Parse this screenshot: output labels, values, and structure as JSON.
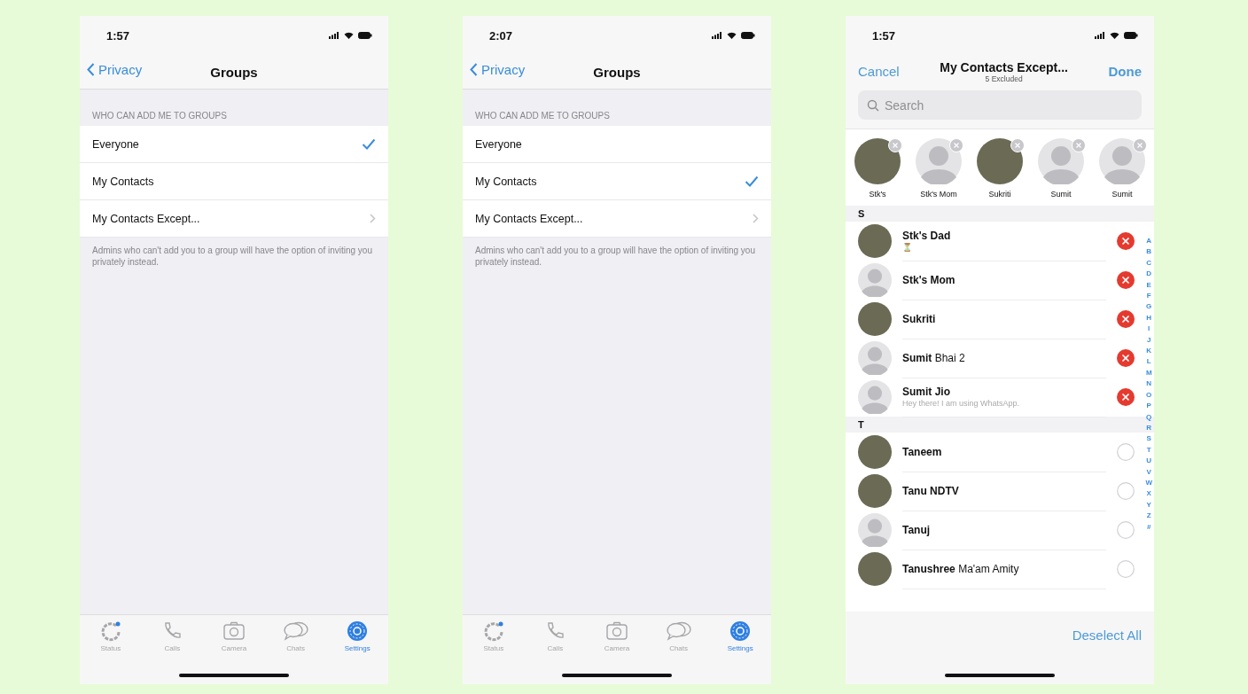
{
  "screens": [
    {
      "kind": "settings",
      "time": "1:57",
      "back_label": "Privacy",
      "title": "Groups",
      "section_header": "WHO CAN ADD ME TO GROUPS",
      "options": [
        {
          "label": "Everyone",
          "selected": true,
          "chevron": false
        },
        {
          "label": "My Contacts",
          "selected": false,
          "chevron": false
        },
        {
          "label": "My Contacts Except...",
          "selected": false,
          "chevron": true
        }
      ],
      "footer": "Admins who can't add you to a group will have the option of inviting you privately instead.",
      "tabs": [
        {
          "label": "Status",
          "selected": false
        },
        {
          "label": "Calls",
          "selected": false
        },
        {
          "label": "Camera",
          "selected": false
        },
        {
          "label": "Chats",
          "selected": false
        },
        {
          "label": "Settings",
          "selected": true
        }
      ]
    },
    {
      "kind": "settings",
      "time": "2:07",
      "back_label": "Privacy",
      "title": "Groups",
      "section_header": "WHO CAN ADD ME TO GROUPS",
      "options": [
        {
          "label": "Everyone",
          "selected": false,
          "chevron": false
        },
        {
          "label": "My Contacts",
          "selected": true,
          "chevron": false
        },
        {
          "label": "My Contacts Except...",
          "selected": false,
          "chevron": true
        }
      ],
      "footer": "Admins who can't add you to a group will have the option of inviting you privately instead.",
      "tabs": [
        {
          "label": "Status",
          "selected": false
        },
        {
          "label": "Calls",
          "selected": false
        },
        {
          "label": "Camera",
          "selected": false
        },
        {
          "label": "Chats",
          "selected": false
        },
        {
          "label": "Settings",
          "selected": true
        }
      ]
    },
    {
      "kind": "picker",
      "time": "1:57",
      "cancel": "Cancel",
      "title": "My Contacts Except...",
      "subtitle": "5 Excluded",
      "done": "Done",
      "search": {
        "placeholder": "Search"
      },
      "chips": [
        {
          "name": "Stk's",
          "photo": true
        },
        {
          "name": "Stk's Mom",
          "photo": false
        },
        {
          "name": "Sukriti",
          "photo": true
        },
        {
          "name": "Sumit",
          "photo": false
        },
        {
          "name": "Sumit",
          "photo": false
        }
      ],
      "sections": [
        {
          "letter": "S",
          "contacts": [
            {
              "name": "Stk's Dad",
              "bold": true,
              "status": "⏳",
              "photo": true,
              "excluded": true
            },
            {
              "name": "Stk's Mom",
              "bold": true,
              "photo": false,
              "excluded": true
            },
            {
              "name": "Sukriti",
              "bold": true,
              "photo": true,
              "excluded": true
            },
            {
              "name": "**Sumit** Bhai 2",
              "bold": false,
              "photo": false,
              "excluded": true
            },
            {
              "name": "Sumit Jio",
              "bold": true,
              "status": "Hey there! I am using WhatsApp.",
              "photo": false,
              "excluded": true
            }
          ]
        },
        {
          "letter": "T",
          "contacts": [
            {
              "name": "Taneem",
              "bold": true,
              "photo": true,
              "excluded": false
            },
            {
              "name": "Tanu NDTV",
              "bold": true,
              "photo": true,
              "excluded": false
            },
            {
              "name": "Tanuj",
              "bold": true,
              "photo": false,
              "excluded": false
            },
            {
              "name": "**Tanushree** Ma'am Amity",
              "bold": false,
              "photo": true,
              "excluded": false
            }
          ]
        }
      ],
      "index": [
        "A",
        "B",
        "C",
        "D",
        "E",
        "F",
        "G",
        "H",
        "I",
        "J",
        "K",
        "L",
        "M",
        "N",
        "O",
        "P",
        "Q",
        "R",
        "S",
        "T",
        "U",
        "V",
        "W",
        "X",
        "Y",
        "Z",
        "#"
      ],
      "deselect": "Deselect All"
    }
  ]
}
